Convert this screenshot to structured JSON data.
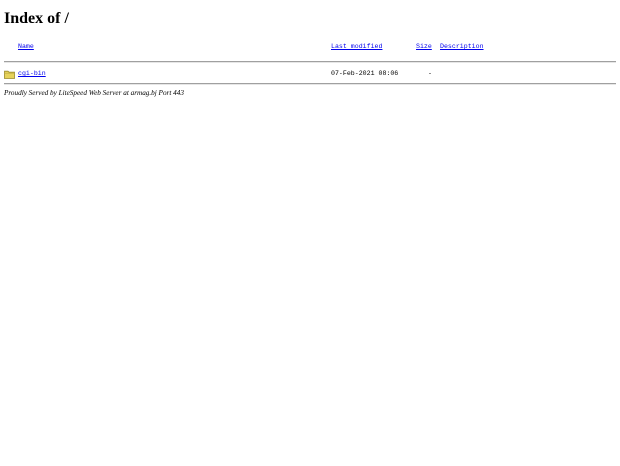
{
  "page": {
    "title": "Index of /"
  },
  "table": {
    "headers": {
      "name": "Name",
      "last_modified": "Last modified",
      "size": "Size",
      "description": "Description"
    },
    "rows": [
      {
        "icon": "folder-icon",
        "name": "cgi-bin",
        "last_modified": "07-Feb-2021 08:06",
        "size": "-",
        "description": ""
      }
    ]
  },
  "footer": {
    "text": "Proudly Served by LiteSpeed Web Server at armag.bj Port 443"
  }
}
